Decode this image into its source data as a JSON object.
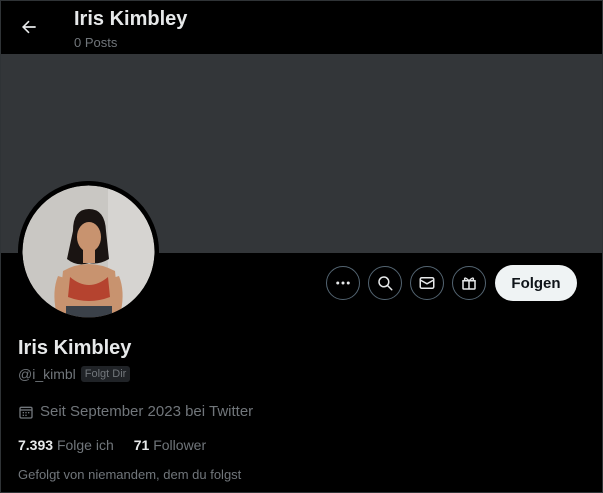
{
  "header": {
    "name": "Iris Kimbley",
    "posts": "0 Posts"
  },
  "profile": {
    "name": "Iris Kimbley",
    "handle": "@i_kimbl",
    "follows_you_badge": "Folgt Dir",
    "joined": "Seit September 2023 bei Twitter",
    "following_count": "7.393",
    "following_label": "Folge ich",
    "followers_count": "71",
    "followers_label": "Follower",
    "followed_by": "Gefolgt von niemandem, dem du folgst"
  },
  "actions": {
    "follow_label": "Folgen",
    "icons": [
      "more-icon",
      "search-icon",
      "mail-icon",
      "gift-icon"
    ]
  },
  "colors": {
    "background": "#000000",
    "banner": "#333639",
    "text_primary": "#e7e9ea",
    "text_secondary": "#71767b",
    "button_border": "#536471",
    "follow_bg": "#eff3f4"
  }
}
